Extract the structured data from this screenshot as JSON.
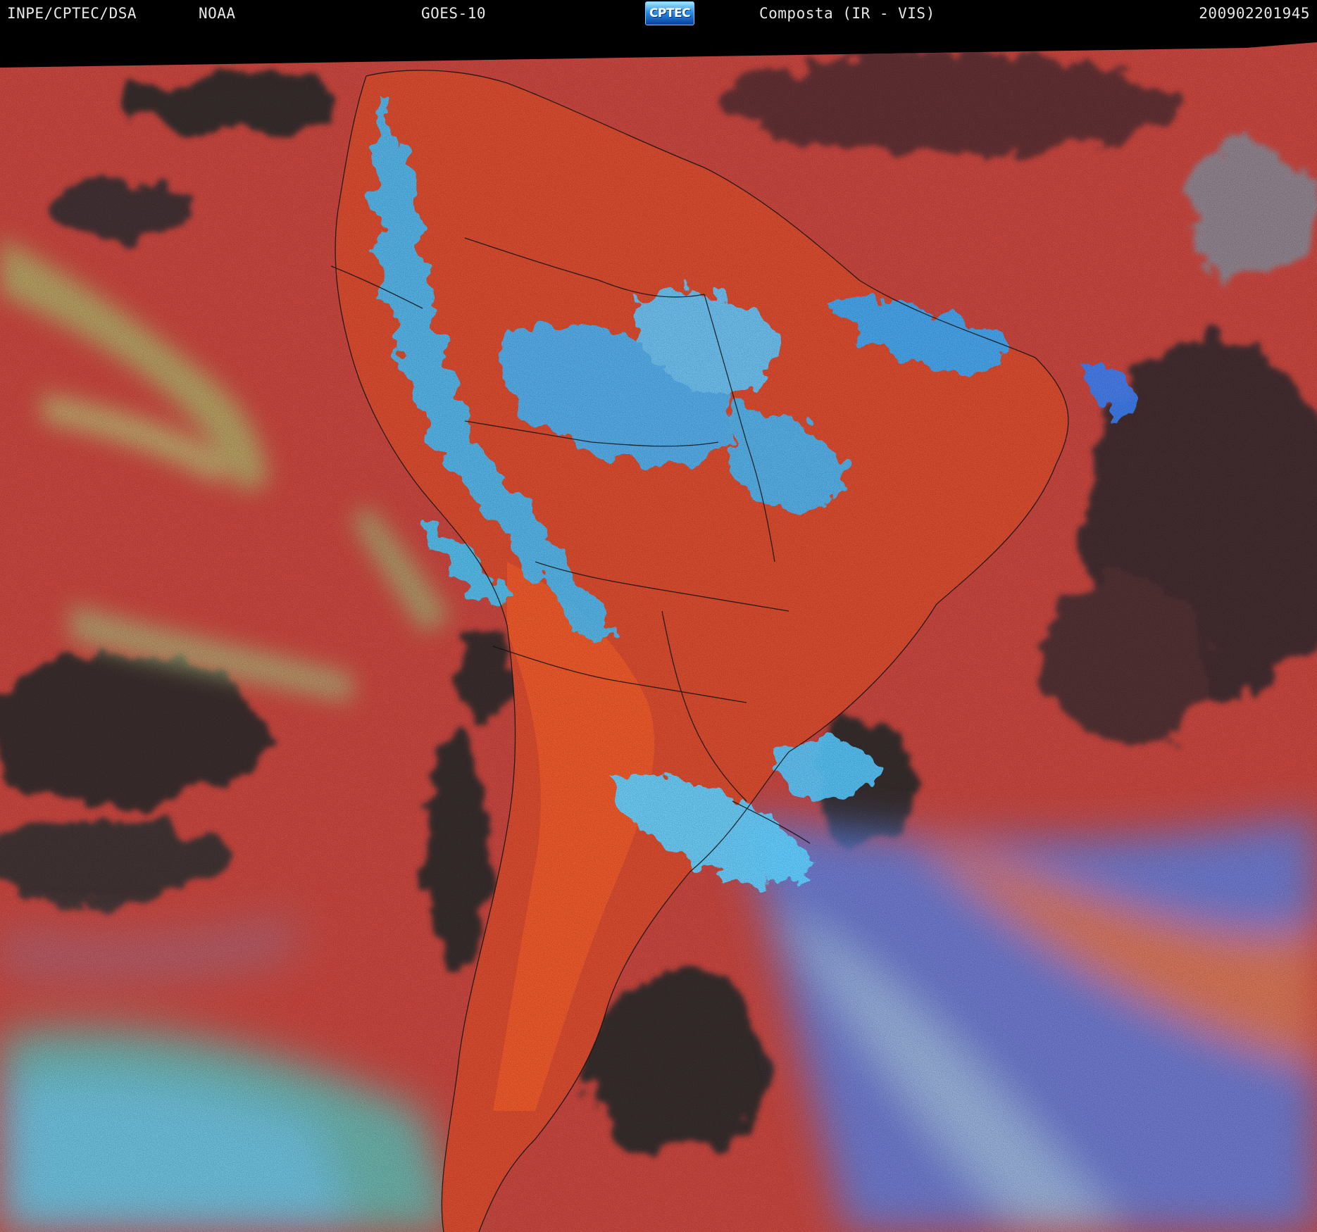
{
  "header": {
    "agency": "INPE/CPTEC/DSA",
    "source": "NOAA",
    "satellite": "GOES-10",
    "logo_text": "CPTEC",
    "product": "Composta (IR - VIS)",
    "datetime": "200902201945"
  },
  "colors": {
    "background": "#000000",
    "header_text": "#e8e8e8",
    "clear_sky": "#c8463f",
    "land_warm": "#e0552c",
    "cold_cloud_top": "#3ec6ff",
    "low_cloud": "#9ec47a",
    "dark_ocean": "#2f2a2a",
    "border_lines": "#111111"
  }
}
